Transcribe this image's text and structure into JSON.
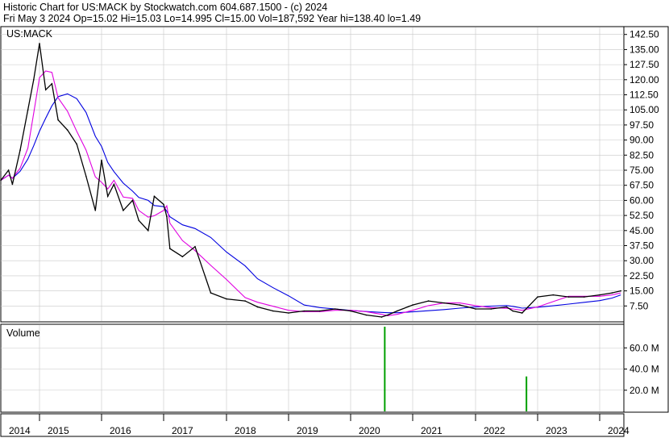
{
  "header": {
    "line1": "Historic Chart for US:MACK by Stockwatch.com 604.687.1500 - (c) 2024",
    "line2": "Fri May  3 2024   Op=15.02  Hi=15.03  Lo=14.995  Cl=15.00  Vol=187,592  Year hi=138.40  lo=1.49"
  },
  "colors": {
    "price": "#000000",
    "ma_short": "#e000e0",
    "ma_long": "#0000e0",
    "volume": "#00a000",
    "grid": "#c8c8c8"
  },
  "chart_data": [
    {
      "type": "line",
      "title": "US:MACK",
      "ylim": [
        0,
        146
      ],
      "y_ticks": [
        "142.50",
        "135.00",
        "127.50",
        "120.00",
        "112.50",
        "105.00",
        "97.50",
        "90.00",
        "82.50",
        "75.00",
        "67.50",
        "60.00",
        "52.50",
        "45.00",
        "37.50",
        "30.00",
        "22.50",
        "15.00",
        "7.50"
      ],
      "x_ticks": [
        "2014",
        "2015",
        "2016",
        "2017",
        "2018",
        "2019",
        "2020",
        "2021",
        "2022",
        "2023",
        "2024"
      ],
      "x": [
        2014.0,
        2014.2,
        2014.3,
        2014.5,
        2014.7,
        2014.85,
        2015.0,
        2015.1,
        2015.2,
        2015.3,
        2015.45,
        2015.6,
        2015.75,
        2015.9,
        2016.0,
        2016.1,
        2016.2,
        2016.35,
        2016.5,
        2016.6,
        2016.75,
        2016.85,
        2017.0,
        2017.05,
        2017.1,
        2017.3,
        2017.5,
        2017.75,
        2018.0,
        2018.3,
        2018.5,
        2018.75,
        2019.0,
        2019.25,
        2019.5,
        2019.75,
        2020.0,
        2020.25,
        2020.5,
        2020.6,
        2020.75,
        2021.0,
        2021.25,
        2021.5,
        2021.75,
        2022.0,
        2022.25,
        2022.5,
        2022.6,
        2022.75,
        2023.0,
        2023.25,
        2023.5,
        2023.75,
        2024.0,
        2024.2,
        2024.34
      ],
      "series": [
        {
          "name": "",
          "values": [
            70,
            75,
            68,
            85,
            105,
            120,
            138,
            115,
            118,
            100,
            95,
            88,
            72,
            55,
            80,
            62,
            68,
            55,
            60,
            50,
            45,
            62,
            58,
            52,
            36,
            32,
            37,
            14,
            11,
            10,
            7,
            5,
            4,
            5,
            5,
            6,
            5,
            3,
            2,
            3,
            5,
            8,
            10,
            9,
            8,
            6,
            6,
            7,
            5,
            4,
            12,
            13,
            12,
            12,
            13,
            14,
            15
          ]
        }
      ],
      "moving_averages": [
        {
          "name": "",
          "color": "#e000e0",
          "period_points": 3
        },
        {
          "name": "",
          "color": "#0000e0",
          "period_points": 7
        }
      ]
    },
    {
      "type": "bar",
      "title": "Volume",
      "ylim": [
        0,
        80
      ],
      "y_ticks": [
        "60.0 M",
        "40.0 M",
        "20.0 M"
      ],
      "spikes": [
        {
          "x": 2020.55,
          "value": 80
        },
        {
          "x": 2022.82,
          "value": 33
        }
      ]
    }
  ]
}
